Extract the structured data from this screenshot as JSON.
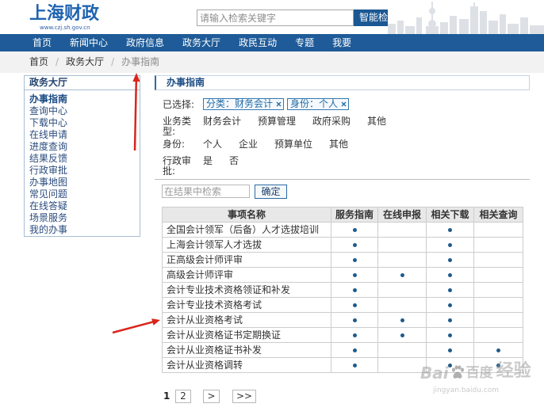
{
  "header": {
    "logo_text": "上海财政",
    "logo_url": "www.czj.sh.gov.cn",
    "search_placeholder": "请输入检索关键字",
    "search_button": "智能检"
  },
  "nav": {
    "items": [
      "首页",
      "新闻中心",
      "政府信息",
      "政务大厅",
      "政民互动",
      "专题",
      "我要"
    ]
  },
  "breadcrumb": {
    "items": [
      "首页",
      "政务大厅",
      "办事指南"
    ],
    "separator": "/"
  },
  "sidebar": {
    "title": "政务大厅",
    "active_index": 0,
    "items": [
      "办事指南",
      "查询中心",
      "下载中心",
      "在线申请",
      "进度查询",
      "结果反馈",
      "行政审批",
      "办事地图",
      "常见问题",
      "在线答疑",
      "场景服务",
      "我的办事"
    ]
  },
  "main": {
    "title": "办事指南",
    "selected_label": "已选择:",
    "selected_tags": [
      "分类：财务会计",
      "身份：个人"
    ],
    "filters": [
      {
        "label": "业务类型:",
        "options": [
          "财务会计",
          "预算管理",
          "政府采购",
          "其他"
        ]
      },
      {
        "label": "身份:",
        "options": [
          "个人",
          "企业",
          "预算单位",
          "其他"
        ]
      },
      {
        "label": "行政审批:",
        "options": [
          "是",
          "否"
        ]
      }
    ],
    "result_search": {
      "placeholder": "在结果中检索",
      "button": "确定"
    },
    "table": {
      "columns": [
        "事项名称",
        "服务指南",
        "在线申报",
        "相关下载",
        "相关查询"
      ],
      "rows": [
        {
          "name": "全国会计领军（后备）人才选拔培训",
          "flags": [
            true,
            false,
            true,
            false
          ]
        },
        {
          "name": "上海会计领军人才选拔",
          "flags": [
            true,
            false,
            true,
            false
          ]
        },
        {
          "name": "正高级会计师评审",
          "flags": [
            true,
            false,
            true,
            false
          ]
        },
        {
          "name": "高级会计师评审",
          "flags": [
            true,
            true,
            true,
            false
          ]
        },
        {
          "name": "会计专业技术资格领证和补发",
          "flags": [
            true,
            false,
            true,
            false
          ]
        },
        {
          "name": "会计专业技术资格考试",
          "flags": [
            true,
            false,
            true,
            false
          ]
        },
        {
          "name": "会计从业资格考试",
          "flags": [
            true,
            true,
            true,
            false
          ]
        },
        {
          "name": "会计从业资格证书定期换证",
          "flags": [
            true,
            true,
            true,
            false
          ]
        },
        {
          "name": "会计从业资格证书补发",
          "flags": [
            true,
            false,
            true,
            true
          ]
        },
        {
          "name": "会计从业资格调转",
          "flags": [
            true,
            false,
            true,
            true
          ]
        }
      ]
    },
    "pagination": {
      "pages": [
        "1",
        "2"
      ],
      "current_index": 0,
      "next": ">",
      "last": ">>"
    }
  },
  "watermark": {
    "brand_latin": "Bai",
    "brand_cn": "百度",
    "section": "经验",
    "url": "jingyan.baidu.com"
  },
  "icons": {
    "tag_remove": "close-icon",
    "watermark_mark": "paw-icon",
    "annotation": "arrow-icon"
  },
  "colors": {
    "brand_blue": "#1f63b0",
    "nav_bg": "#1e5b98",
    "search_button_bg": "#1b5893",
    "dot": "#1e5b8c",
    "annotation_red": "#d9261c"
  }
}
